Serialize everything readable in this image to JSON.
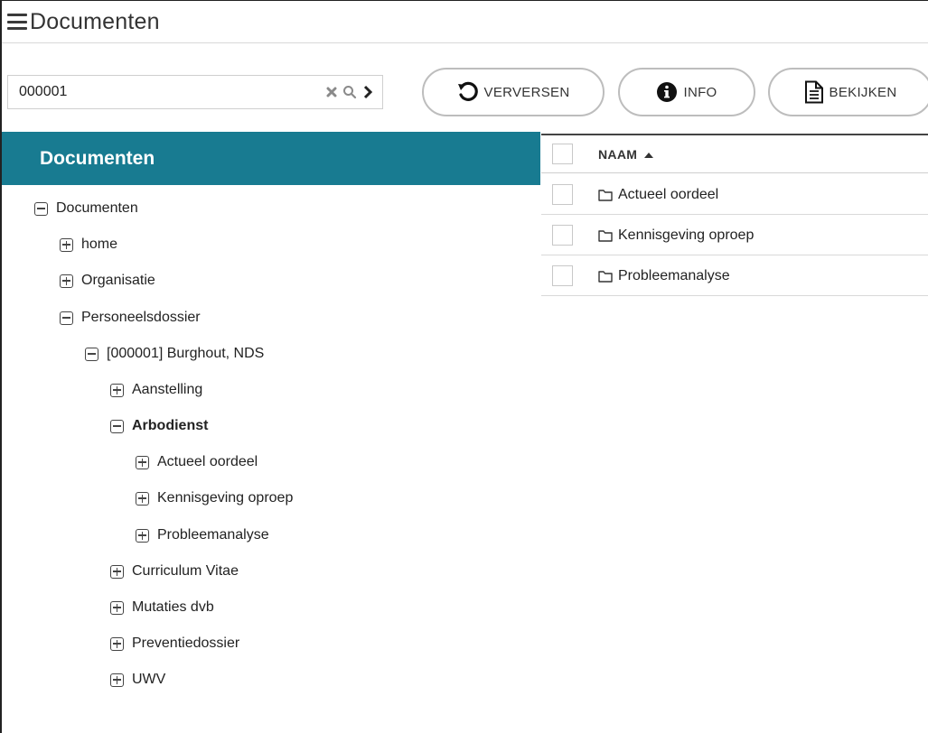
{
  "app": {
    "title": "Documenten"
  },
  "search": {
    "value": "000001"
  },
  "toolbar": {
    "refresh_label": "VERVERSEN",
    "info_label": "INFO",
    "view_label": "BEKIJKEN"
  },
  "sidebar": {
    "header": "Documenten"
  },
  "tree": [
    {
      "label": "Documenten",
      "expanded": true
    },
    {
      "label": "home",
      "expanded": false
    },
    {
      "label": "Organisatie",
      "expanded": false
    },
    {
      "label": "Personeelsdossier",
      "expanded": true
    },
    {
      "label": "[000001] Burghout, NDS",
      "expanded": true
    },
    {
      "label": "Aanstelling",
      "expanded": false
    },
    {
      "label": "Arbodienst",
      "expanded": true,
      "selected": true
    },
    {
      "label": "Actueel oordeel",
      "expanded": false
    },
    {
      "label": "Kennisgeving oproep",
      "expanded": false
    },
    {
      "label": "Probleemanalyse",
      "expanded": false
    },
    {
      "label": "Curriculum Vitae",
      "expanded": false
    },
    {
      "label": "Mutaties dvb",
      "expanded": false
    },
    {
      "label": "Preventiedossier",
      "expanded": false
    },
    {
      "label": "UWV",
      "expanded": false
    }
  ],
  "grid": {
    "column": "NAAM",
    "rows": [
      {
        "name": "Actueel oordeel"
      },
      {
        "name": "Kennisgeving oproep"
      },
      {
        "name": "Probleemanalyse"
      }
    ]
  },
  "colors": {
    "header_bg": "#187b91",
    "header_text": "#ffffff"
  },
  "icons": [
    "menu-icon",
    "clear-icon",
    "search-icon",
    "chevron-right-icon",
    "refresh-icon",
    "info-icon",
    "document-icon",
    "folder-icon",
    "tree-collapse-icon",
    "tree-expand-icon",
    "sort-ascending-icon"
  ]
}
